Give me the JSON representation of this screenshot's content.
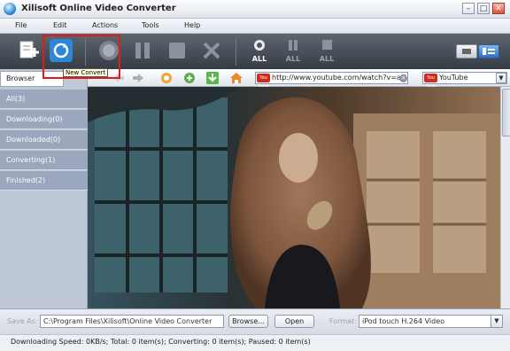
{
  "window": {
    "title": "Xilisoft Online Video Converter",
    "minimize": "–",
    "maximize": "□",
    "close": "✕"
  },
  "menu": [
    "File",
    "Edit",
    "Actions",
    "Tools",
    "Help"
  ],
  "toolbar": {
    "all_labels": [
      "ALL",
      "ALL",
      "ALL"
    ],
    "tooltip": "New Convert"
  },
  "sidebar": {
    "header": "Browser",
    "items": [
      "All(3)",
      "Downloading(0)",
      "Downloaded(0)",
      "Converting(1)",
      "Finished(2)"
    ]
  },
  "browser": {
    "url": "http://www.youtube.com/watch?v=aU",
    "site": "YouTube",
    "yt_badge": "You Tube"
  },
  "bottom": {
    "save_as_label": "Save As:",
    "save_path": "C:\\Program Files\\Xilisoft\\Online Video Converter",
    "browse": "Browse...",
    "open": "Open",
    "format_label": "Format:",
    "format": "iPod touch H.264 Video"
  },
  "status": "Downloading Speed: 0KB/s; Total: 0 item(s); Converting: 0 item(s); Paused: 0 item(s)",
  "colors": {
    "sidebar_item": "#9aa7bd",
    "sidebar_active": "#7f8fa8",
    "highlight": "#e01b1b"
  }
}
